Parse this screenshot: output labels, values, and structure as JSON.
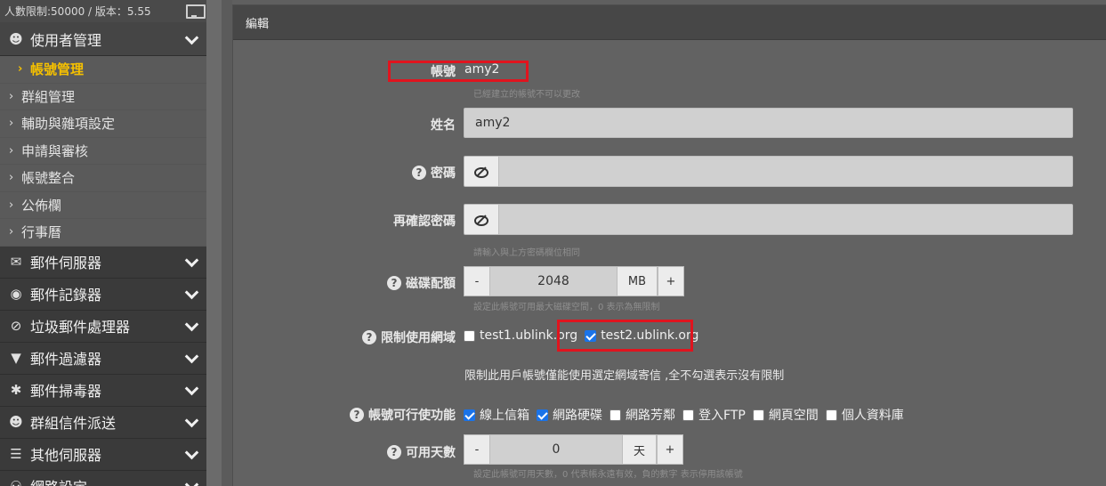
{
  "sidebar": {
    "top_text": "人數限制:50000 / 版本：5.55",
    "active_section": {
      "label": "使用者管理",
      "icon": "user-icon"
    },
    "subitems": [
      {
        "label": "帳號管理",
        "current": true
      },
      {
        "label": "群組管理"
      },
      {
        "label": "輔助與雜項設定"
      },
      {
        "label": "申請與審核"
      },
      {
        "label": "帳號整合"
      },
      {
        "label": "公佈欄"
      },
      {
        "label": "行事曆"
      }
    ],
    "sections": [
      {
        "label": "郵件伺服器",
        "icon": "envelope-icon",
        "glyph": "✉"
      },
      {
        "label": "郵件記錄器",
        "icon": "camera-icon",
        "glyph": "◉"
      },
      {
        "label": "垃圾郵件處理器",
        "icon": "ban-icon",
        "glyph": "⊘"
      },
      {
        "label": "郵件過濾器",
        "icon": "filter-icon",
        "glyph": "▼"
      },
      {
        "label": "郵件掃毒器",
        "icon": "bug-icon",
        "glyph": "✱"
      },
      {
        "label": "群組信件派送",
        "icon": "users-icon",
        "glyph": "☻"
      },
      {
        "label": "其他伺服器",
        "icon": "server-icon",
        "glyph": "☰"
      },
      {
        "label": "網路設定",
        "icon": "network-icon",
        "glyph": "⚇"
      }
    ]
  },
  "panel": {
    "title": "編輯",
    "account": {
      "label": "帳號",
      "value": "amy2",
      "help": "已經建立的帳號不可以更改"
    },
    "name": {
      "label": "姓名",
      "value": "amy2"
    },
    "password": {
      "label": "密碼"
    },
    "confirm_password": {
      "label": "再確認密碼",
      "help": "請輸入與上方密碼欄位相同"
    },
    "quota": {
      "label": "磁碟配額",
      "minus": "-",
      "value": "2048",
      "unit": "MB",
      "plus": "+",
      "help": "設定此帳號可用最大磁碟空間，0 表示為無限制"
    },
    "domains": {
      "label": "限制使用網域",
      "options": [
        {
          "label": "test1.ublink.org",
          "checked": false
        },
        {
          "label": "test2.ublink.org",
          "checked": true
        }
      ],
      "note": "限制此用戶帳號僅能使用選定網域寄信 ,全不勾選表示沒有限制"
    },
    "features": {
      "label": "帳號可行使功能",
      "options": [
        {
          "label": "線上信箱",
          "checked": true
        },
        {
          "label": "網路硬碟",
          "checked": true
        },
        {
          "label": "網路芳鄰",
          "checked": false
        },
        {
          "label": "登入FTP",
          "checked": false
        },
        {
          "label": "網頁空間",
          "checked": false
        },
        {
          "label": "個人資料庫",
          "checked": false
        }
      ]
    },
    "days": {
      "label": "可用天數",
      "minus": "-",
      "value": "0",
      "unit": "天",
      "plus": "+",
      "help": "設定此帳號可用天數，0 代表帳永遠有效，負的數字 表示停用該帳號"
    }
  },
  "colors": {
    "highlight": "#e0141e",
    "active_item": "#f5c000",
    "checkbox": "#1a73e8"
  }
}
